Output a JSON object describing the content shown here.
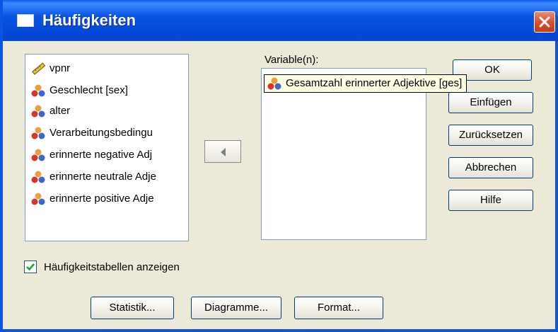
{
  "window": {
    "title": "Häufigkeiten",
    "title_icon": "window-icon",
    "close_icon": "close-icon"
  },
  "source_list": {
    "items": [
      {
        "label": "vpnr",
        "icon": "ruler-icon"
      },
      {
        "label": "Geschlecht [sex]",
        "icon": "nominal-variable-icon"
      },
      {
        "label": "alter",
        "icon": "nominal-variable-icon"
      },
      {
        "label": "Verarbeitungsbedingu",
        "icon": "nominal-variable-icon"
      },
      {
        "label": "erinnerte negative Adj",
        "icon": "nominal-variable-icon"
      },
      {
        "label": "erinnerte neutrale Adje",
        "icon": "nominal-variable-icon"
      },
      {
        "label": "erinnerte positive Adje",
        "icon": "nominal-variable-icon"
      }
    ]
  },
  "move_button": {
    "icon": "arrow-left-icon"
  },
  "target": {
    "label": "Variable(n):",
    "tooltip": "Gesamtzahl erinnerter Adjektive [ges]"
  },
  "buttons": {
    "ok": "OK",
    "paste": "Einfügen",
    "reset": "Zurücksetzen",
    "cancel": "Abbrechen",
    "help": "Hilfe"
  },
  "checkbox": {
    "label": "Häufigkeitstabellen anzeigen",
    "checked": true
  },
  "bottom_buttons": {
    "statistics": "Statistik...",
    "charts": "Diagramme...",
    "format": "Format..."
  },
  "colors": {
    "titlebar": "#0853e1",
    "dialog_bg": "#ece9d8",
    "close_red": "#d8522e",
    "tooltip_bg": "#ffffe1"
  }
}
